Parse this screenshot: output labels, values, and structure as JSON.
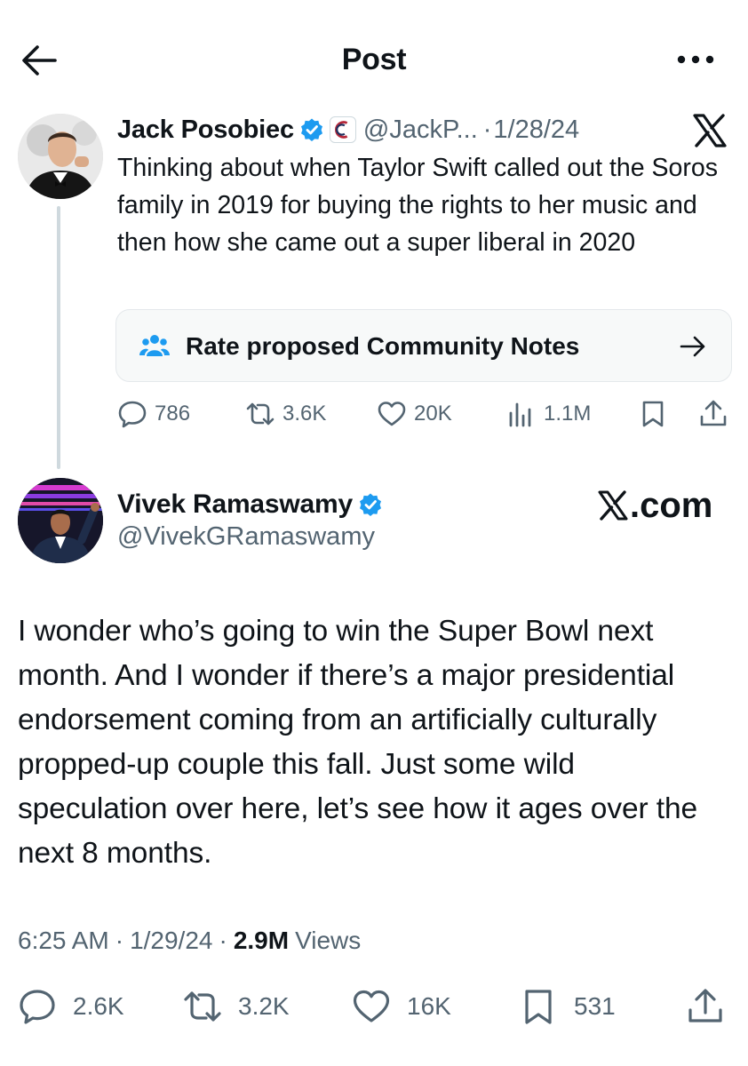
{
  "header": {
    "title": "Post",
    "back_icon": "arrow-left-icon",
    "more_icon": "more-horizontal-icon"
  },
  "parent_post": {
    "author_name": "Jack Posobiec",
    "handle": "@JackP...",
    "separator": "·",
    "date": "1/28/24",
    "text": "Thinking about when Taylor Swift called out the Soros family in 2019 for buying the rights to her music and then how she came out a super liberal in 2020",
    "community_notes_label": "Rate proposed Community Notes",
    "stats": {
      "replies": "786",
      "reposts": "3.6K",
      "likes": "20K",
      "views": "1.1M"
    }
  },
  "main_post": {
    "author_name": "Vivek Ramaswamy",
    "handle": "@VivekGRamaswamy",
    "watermark": ".com",
    "text": "I wonder who’s going to win the Super Bowl next month. And I wonder if there’s a major presidential endorsement coming from an artificially culturally propped-up couple this fall. Just some wild speculation over here, let’s see how it ages over the next 8 months.",
    "time": "6:25 AM",
    "date": "1/29/24",
    "separator": "·",
    "views_count": "2.9M",
    "views_label": "Views",
    "stats": {
      "replies": "2.6K",
      "reposts": "3.2K",
      "likes": "16K",
      "bookmarks": "531"
    }
  },
  "colors": {
    "text_primary": "#0f1419",
    "text_secondary": "#536471",
    "verified_blue": "#1d9bf0",
    "border": "#cfd9de",
    "card_background": "#f7f9f9"
  }
}
